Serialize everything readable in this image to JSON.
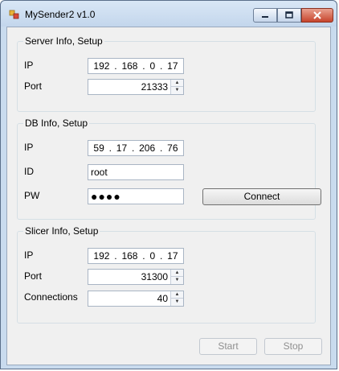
{
  "window": {
    "title": "MySender2 v1.0"
  },
  "server": {
    "group_title": "Server Info, Setup",
    "ip_label": "IP",
    "ip": [
      "192",
      "168",
      "0",
      "17"
    ],
    "port_label": "Port",
    "port": "21333"
  },
  "db": {
    "group_title": "DB Info, Setup",
    "ip_label": "IP",
    "ip": [
      "59",
      "17",
      "206",
      "76"
    ],
    "id_label": "ID",
    "id": "root",
    "pw_label": "PW",
    "pw_mask": "●●●●",
    "connect_label": "Connect"
  },
  "slicer": {
    "group_title": "Slicer Info, Setup",
    "ip_label": "IP",
    "ip": [
      "192",
      "168",
      "0",
      "17"
    ],
    "port_label": "Port",
    "port": "31300",
    "connections_label": "Connections",
    "connections": "40"
  },
  "footer": {
    "start_label": "Start",
    "stop_label": "Stop"
  },
  "icons": {
    "app": "app-icon",
    "minimize": "minimize-icon",
    "maximize": "maximize-icon",
    "close": "close-icon"
  }
}
